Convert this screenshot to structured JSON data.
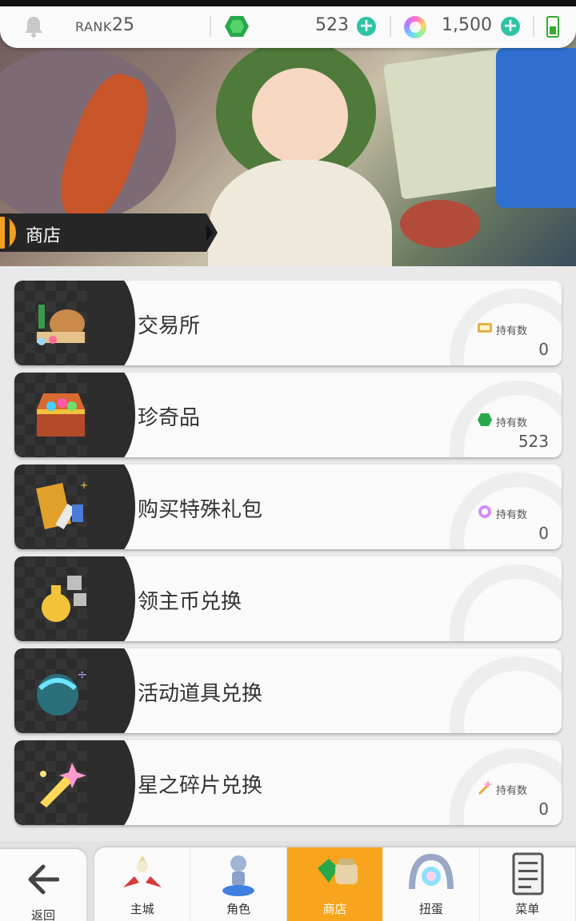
{
  "top_bar": {
    "bell_icon": "bell-icon",
    "rank_label": "RANK",
    "rank_value": "25",
    "gem_amount": "523",
    "orb_amount": "1,500",
    "plus_color": "#2fc4a4"
  },
  "banner": {
    "title": "商店"
  },
  "menu": [
    {
      "label": "交易所",
      "icon": "goods-bundle-icon",
      "hold_label": "持有数",
      "hold_icon": "ticket-icon",
      "hold_value": "0"
    },
    {
      "label": "珍奇品",
      "icon": "treasure-chest-icon",
      "hold_label": "持有数",
      "hold_icon": "green-gem-icon",
      "hold_value": "523"
    },
    {
      "label": "购买特殊礼包",
      "icon": "gift-pack-icon",
      "hold_label": "持有数",
      "hold_icon": "rainbow-orb-icon",
      "hold_value": "0"
    },
    {
      "label": "领主币兑换",
      "icon": "coin-bag-icon"
    },
    {
      "label": "活动道具兑换",
      "icon": "event-orb-icon"
    },
    {
      "label": "星之碎片兑换",
      "icon": "star-shard-icon",
      "hold_label": "持有数",
      "hold_icon": "star-shard-small-icon",
      "hold_value": "0"
    }
  ],
  "bottom_nav": {
    "back_label": "返回",
    "items": [
      {
        "label": "主城",
        "icon": "castle-icon",
        "active": false
      },
      {
        "label": "角色",
        "icon": "character-icon",
        "active": false
      },
      {
        "label": "商店",
        "icon": "shop-icon",
        "active": true
      },
      {
        "label": "扭蛋",
        "icon": "gacha-icon",
        "active": false
      },
      {
        "label": "菜单",
        "icon": "menu-list-icon",
        "active": false
      }
    ],
    "active_color": "#f7a51c"
  }
}
